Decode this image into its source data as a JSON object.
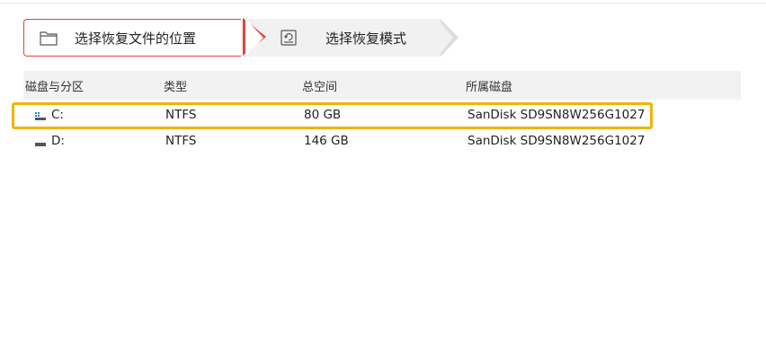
{
  "steps": [
    {
      "label": "选择恢复文件的位置",
      "icon": "folder-icon",
      "active": true
    },
    {
      "label": "选择恢复模式",
      "icon": "disk-restore-icon",
      "active": false
    }
  ],
  "table": {
    "headers": [
      "磁盘与分区",
      "类型",
      "总空间",
      "所属磁盘"
    ],
    "rows": [
      {
        "name": "C:",
        "type": "NTFS",
        "size": "80 GB",
        "disk": "SanDisk SD9SN8W256G1027",
        "icon": "windows-drive-icon",
        "selected": true
      },
      {
        "name": "D:",
        "type": "NTFS",
        "size": "146 GB",
        "disk": "SanDisk SD9SN8W256G1027",
        "icon": "drive-icon",
        "selected": false
      }
    ]
  },
  "colors": {
    "accent_red": "#e2433b",
    "selection": "#f0b400",
    "header_bg": "#f2f2f2"
  }
}
